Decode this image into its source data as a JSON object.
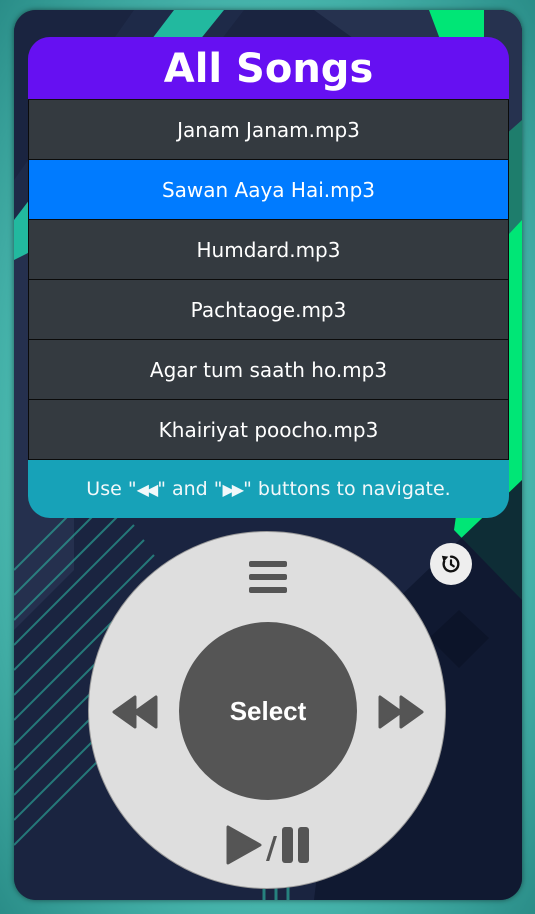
{
  "screen": {
    "title": "All Songs",
    "songs": [
      {
        "label": "Janam Janam.mp3"
      },
      {
        "label": "Sawan Aaya Hai.mp3"
      },
      {
        "label": "Humdard.mp3"
      },
      {
        "label": "Pachtaoge.mp3"
      },
      {
        "label": "Agar tum saath ho.mp3"
      },
      {
        "label": "Khairiyat poocho.mp3"
      }
    ],
    "selected_index": 1,
    "hint": {
      "prefix": "Use \"",
      "between": "\" and \"",
      "suffix": "\" buttons to navigate.",
      "rewind_glyph": "◀◀",
      "forward_glyph": "▶▶"
    }
  },
  "controls": {
    "select_label": "Select",
    "play_pause_separator": "/",
    "icons": {
      "menu": "menu-icon",
      "rewind": "rewind-icon",
      "forward": "fast-forward-icon",
      "play_pause": "play-pause-icon",
      "reset": "rotate-left-icon"
    }
  },
  "colors": {
    "title_bar": "#6610f2",
    "song_bg": "#343a40",
    "selected_song": "#007bff",
    "hint_bar": "#17a2b8",
    "wheel": "#dedede",
    "select_button": "#555555",
    "accent_green": "#00e676"
  }
}
